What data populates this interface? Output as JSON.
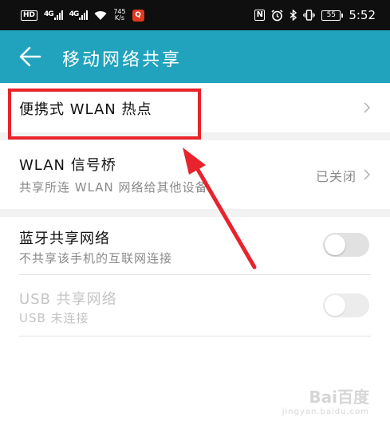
{
  "status_bar": {
    "hd": "HD",
    "signal1": "4G",
    "signal2": "4G",
    "speed_value": "745",
    "speed_unit": "K/s",
    "battery": "55",
    "time": "5:52"
  },
  "app_bar": {
    "title": "移动网络共享",
    "back_icon": "arrow-left-icon",
    "color": "#21a3bd"
  },
  "items": [
    {
      "title": "便携式 WLAN 热点"
    },
    {
      "title": "WLAN 信号桥",
      "subtitle": "共享所连 WLAN 网络给其他设备",
      "value": "已关闭"
    },
    {
      "title": "蓝牙共享网络",
      "subtitle": "不共享该手机的互联网连接",
      "toggle": "off"
    },
    {
      "title": "USB 共享网络",
      "subtitle": "USB 未连接",
      "toggle": "off",
      "enabled": false
    }
  ],
  "annotation": {
    "color": "#e8232c"
  },
  "watermark": {
    "brand": "Bai百度",
    "sub": "jingyan.baidu.com"
  }
}
